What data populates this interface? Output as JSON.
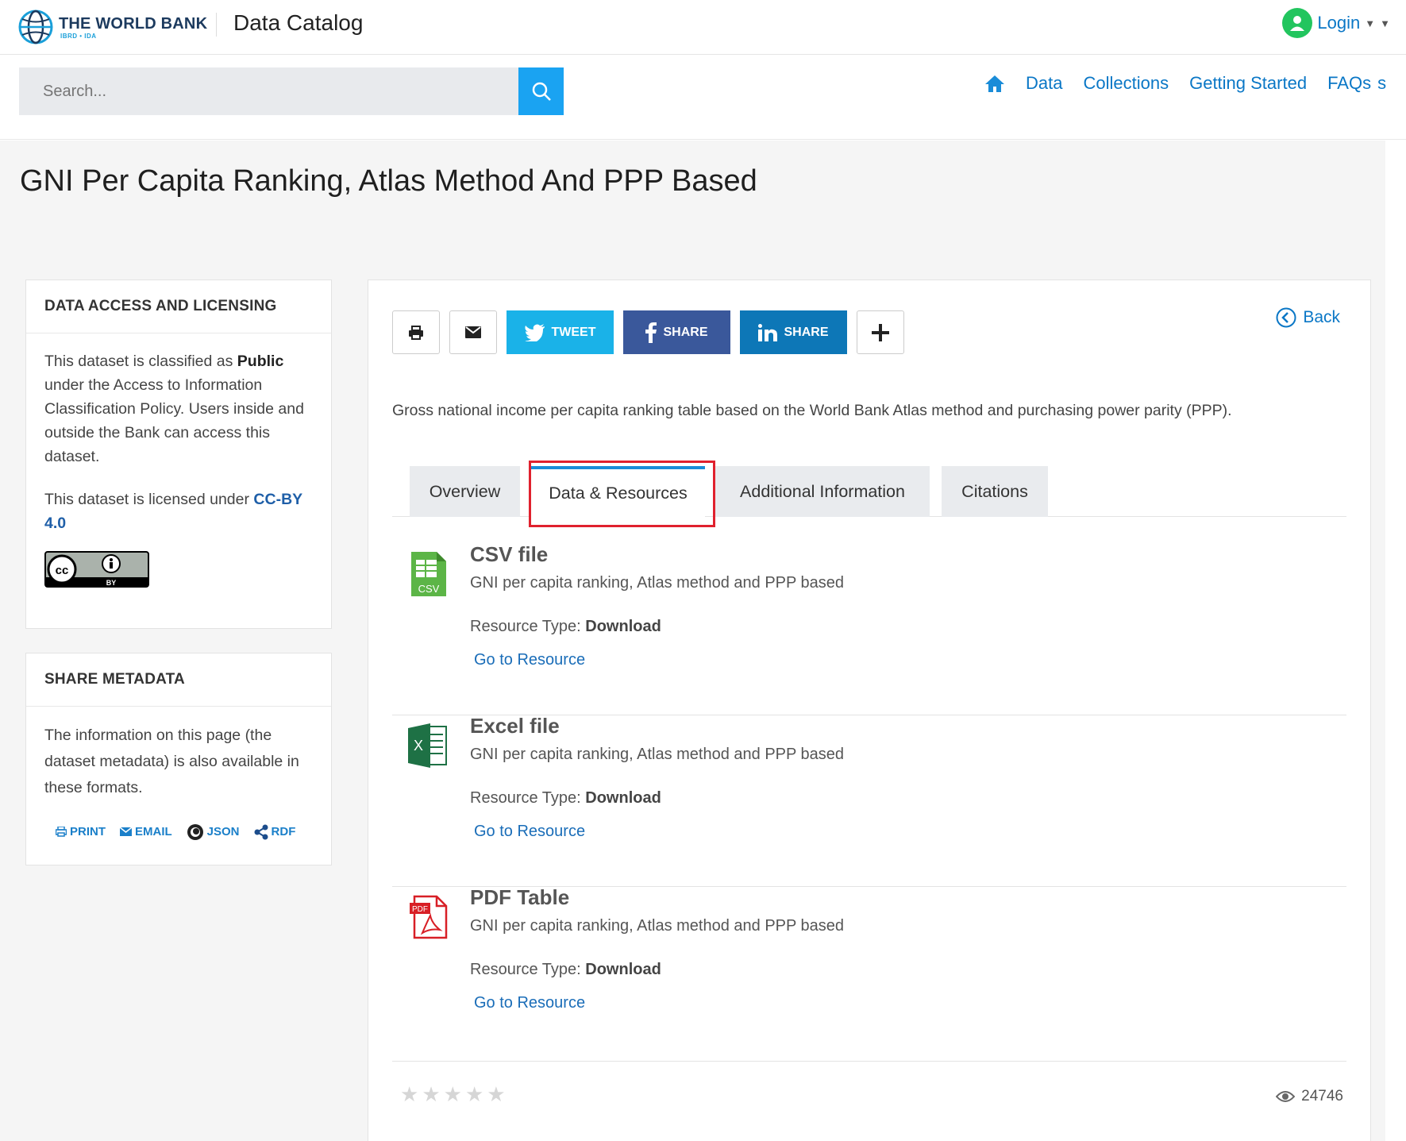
{
  "header": {
    "logo_main": "THE WORLD BANK",
    "logo_sub": "IBRD • IDA",
    "site_title": "Data Catalog",
    "login_label": "Login"
  },
  "search": {
    "placeholder": "Search..."
  },
  "nav": {
    "items": [
      "Data",
      "Collections",
      "Getting Started",
      "FAQs"
    ],
    "overflow_glyph": "s"
  },
  "page": {
    "title": "GNI Per Capita Ranking, Atlas Method And PPP Based"
  },
  "sidebar": {
    "access": {
      "heading": "DATA ACCESS AND LICENSING",
      "p1_a": "This dataset is classified as ",
      "p1_bold": "Public",
      "p1_b": " under the Access to Information Classification Policy. Users inside and outside the Bank can access this dataset.",
      "p2_a": "This dataset is licensed under ",
      "p2_link": "CC-BY 4.0",
      "badge_by": "BY"
    },
    "metadata": {
      "heading": "SHARE METADATA",
      "text": "The information on this page (the dataset metadata) is also available in these formats.",
      "links": [
        "PRINT",
        "EMAIL",
        "JSON",
        "RDF"
      ]
    }
  },
  "main": {
    "share": {
      "tweet": "TWEET",
      "fb": "SHARE",
      "li": "SHARE"
    },
    "back_label": "Back",
    "description": "Gross national income per capita ranking table based on the World Bank Atlas method and purchasing power parity (PPP).",
    "tabs": [
      "Overview",
      "Data & Resources",
      "Additional Information",
      "Citations"
    ],
    "active_tab": "Data & Resources",
    "resources": [
      {
        "title": "CSV file",
        "subtitle": "GNI per capita ranking, Atlas method and PPP based",
        "type_label": "Resource Type: ",
        "type_value": "Download",
        "link": "Go to Resource",
        "icon": "csv-file-icon",
        "icon_text": "CSV"
      },
      {
        "title": "Excel file",
        "subtitle": "GNI per capita ranking, Atlas method and PPP based",
        "type_label": "Resource Type: ",
        "type_value": "Download",
        "link": "Go to Resource",
        "icon": "excel-file-icon",
        "icon_text": "X"
      },
      {
        "title": "PDF Table",
        "subtitle": "GNI per capita ranking, Atlas method and PPP based",
        "type_label": "Resource Type: ",
        "type_value": "Download",
        "link": "Go to Resource",
        "icon": "pdf-file-icon",
        "icon_text": "PDF"
      }
    ],
    "rating": 0,
    "views": "24746"
  },
  "colors": {
    "accent": "#1aa3f2",
    "link": "#0a77c6",
    "twitter": "#1ab2e8",
    "facebook": "#3a589b",
    "linkedin": "#0d77b7",
    "highlight": "#e0212e"
  }
}
